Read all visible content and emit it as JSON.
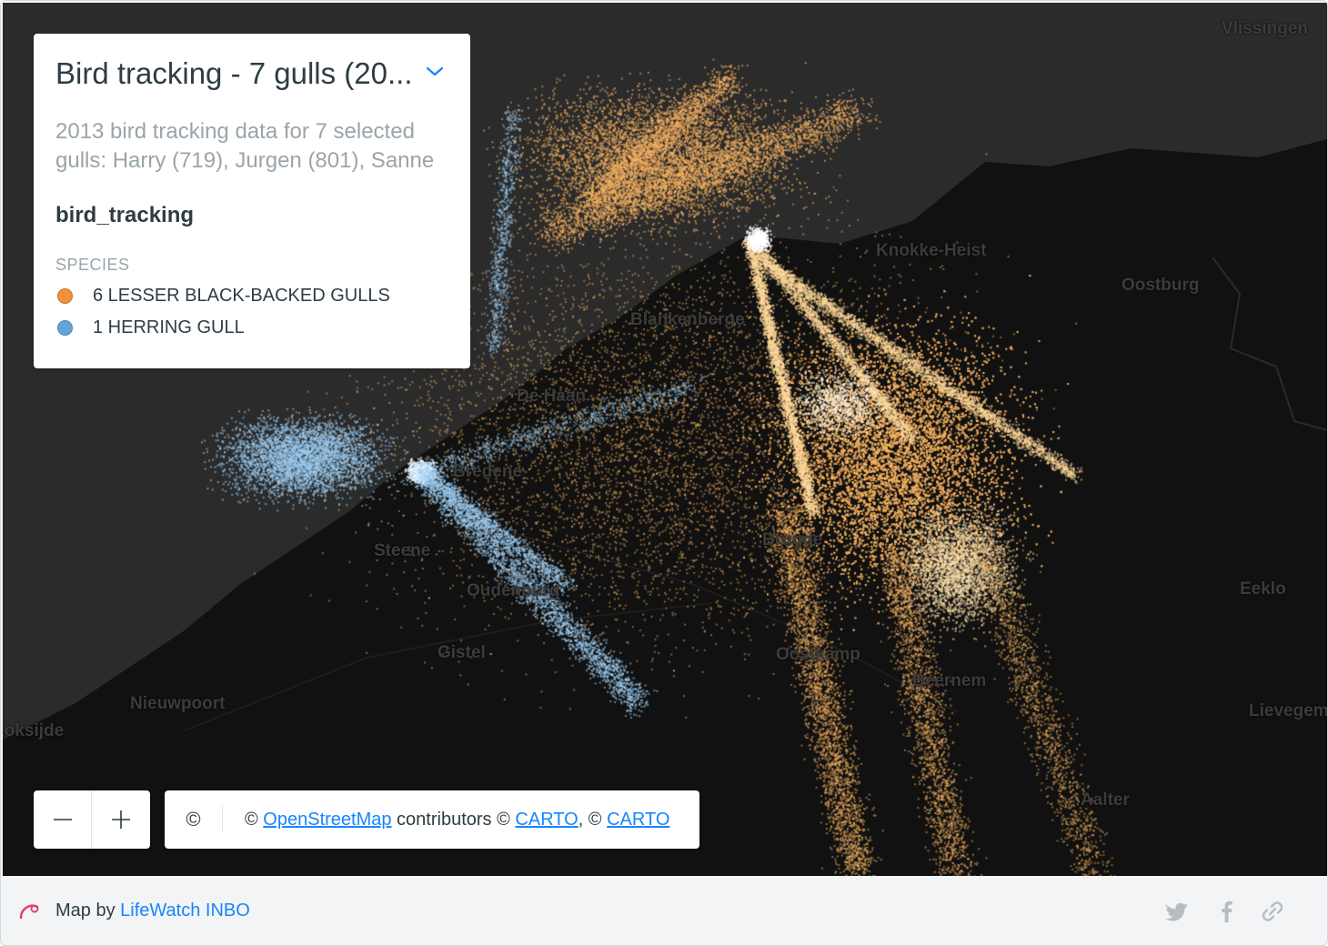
{
  "legend": {
    "title": "Bird tracking - 7 gulls (20...",
    "description": "2013 bird tracking data for 7 selected gulls: Harry (719), Jurgen (801), Sanne",
    "layer_name": "bird_tracking",
    "section_label": "SPECIES",
    "items": [
      {
        "label": "6 LESSER BLACK-BACKED GULLS",
        "color": "#f2913c"
      },
      {
        "label": "1 HERRING GULL",
        "color": "#5fa6d6"
      }
    ]
  },
  "map": {
    "places": [
      "Vlissingen",
      "Knokke-Heist",
      "Oostburg",
      "Blankenberge",
      "De Haan",
      "Bredene",
      "Steene",
      "Oudenburg",
      "Gistel",
      "Nieuwpoort",
      "Koksijde",
      "Brugge",
      "Oostkamp",
      "Beernem",
      "Eeklo",
      "Lievegem",
      "Aalter"
    ],
    "colors": {
      "land": "#111111",
      "sea": "#2c2c2c",
      "lesser_black_backed": "#f6b362",
      "herring": "#9ccdf2"
    }
  },
  "attribution": {
    "symbol": "©",
    "prefix": "© ",
    "osm_link": "OpenStreetMap",
    "middle": " contributors © ",
    "carto1": "CARTO",
    "sep": ", © ",
    "carto2": "CARTO"
  },
  "footer": {
    "map_by": "Map by ",
    "org": "LifeWatch INBO"
  },
  "share_icons": [
    "twitter-icon",
    "facebook-icon",
    "link-icon"
  ]
}
